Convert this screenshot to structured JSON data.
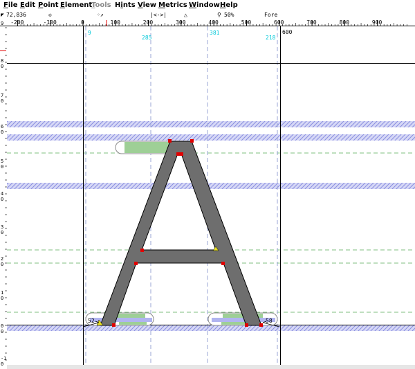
{
  "menu": [
    {
      "label": "File",
      "u": "F",
      "enabled": true
    },
    {
      "label": "Edit",
      "u": "E",
      "enabled": true
    },
    {
      "label": "Point",
      "u": "P",
      "enabled": true
    },
    {
      "label": "Element",
      "u": "E",
      "enabled": true
    },
    {
      "label": "Tools",
      "u": "T",
      "enabled": false
    },
    {
      "label": "Hints",
      "u": "i",
      "enabled": true
    },
    {
      "label": "View",
      "u": "V",
      "enabled": true
    },
    {
      "label": "Metrics",
      "u": "M",
      "enabled": true
    },
    {
      "label": "Window",
      "u": "W",
      "enabled": true
    },
    {
      "label": "Help",
      "u": "H",
      "enabled": true
    }
  ],
  "info": {
    "cursor_pos": "72,836",
    "width_indicator": "|<->|",
    "zoom": "50%",
    "layer": "Fore"
  },
  "ruler": {
    "ticks": [
      "-200",
      "-100",
      "0",
      "100",
      "200",
      "300",
      "400",
      "500",
      "600",
      "700",
      "800",
      "900"
    ],
    "left_corner": "9",
    "left_labels": [
      "8",
      "7",
      "6",
      "5",
      "4",
      "3",
      "2",
      "1",
      "0",
      "-1"
    ],
    "advance_label": "600"
  },
  "hint_labels": {
    "stem_positions": [
      "9",
      "285",
      "381",
      "218"
    ],
    "serif_widths": [
      "52",
      "58"
    ]
  },
  "colors": {
    "glyph_fill": "#6e6e6e",
    "hint_blue": "#b0b4f0",
    "hint_green": "#9ecf96",
    "guide_green": "#7fbf7f",
    "point_red": "#e00000",
    "cyan_label": "#00c8d8"
  }
}
